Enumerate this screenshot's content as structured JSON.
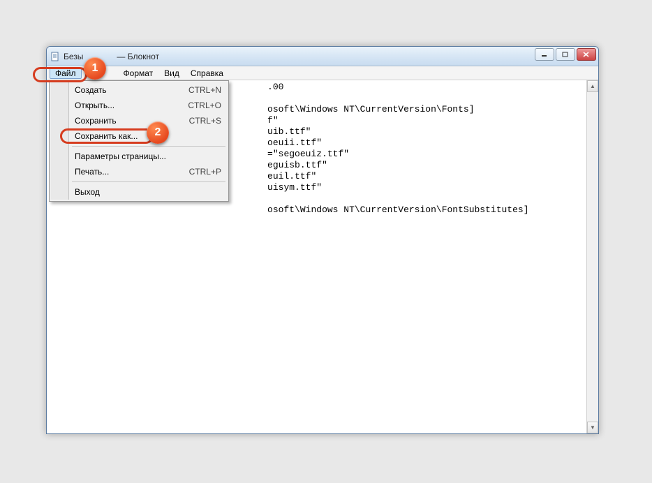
{
  "window": {
    "title_pre": "Безы",
    "title_post": "— Блокнот"
  },
  "menubar": {
    "file": "Файл",
    "format": "Формат",
    "view": "Вид",
    "help": "Справка"
  },
  "file_menu": {
    "new": {
      "label": "Создать",
      "shortcut": "CTRL+N"
    },
    "open": {
      "label": "Открыть...",
      "shortcut": "CTRL+O"
    },
    "save": {
      "label": "Сохранить",
      "shortcut": "CTRL+S"
    },
    "save_as": {
      "label": "Сохранить как...",
      "shortcut": ""
    },
    "page_setup": {
      "label": "Параметры страницы...",
      "shortcut": ""
    },
    "print": {
      "label": "Печать...",
      "shortcut": "CTRL+P"
    },
    "exit": {
      "label": "Выход",
      "shortcut": ""
    }
  },
  "document_lines": [
    "                                        .00",
    "",
    "                                        osoft\\Windows NT\\CurrentVersion\\Fonts]",
    "                                        f\"",
    "                                        uib.ttf\"",
    "                                        oeuii.ttf\"",
    "                                        =\"segoeuiz.ttf\"",
    "                                        eguisb.ttf\"",
    "                                        euil.ttf\"",
    "                                        uisym.ttf\"",
    "",
    "                                        osoft\\Windows NT\\CurrentVersion\\FontSubstitutes]"
  ],
  "annotations": {
    "marker1": "1",
    "marker2": "2"
  }
}
